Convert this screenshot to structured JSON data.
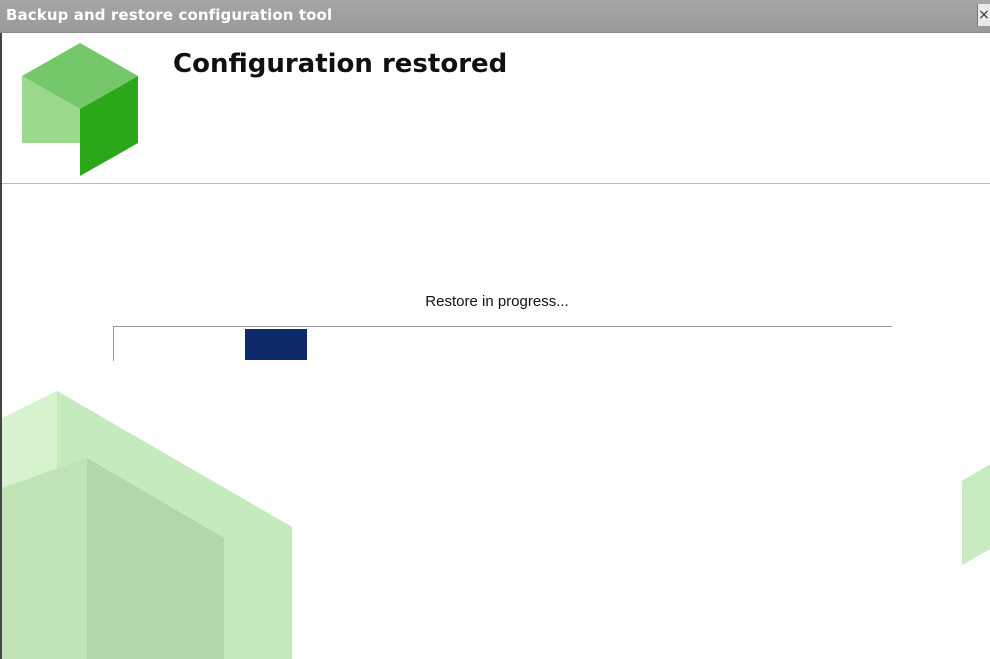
{
  "window": {
    "title": "Backup and restore configuration tool",
    "close_glyph": "×"
  },
  "header": {
    "title": "Configuration restored",
    "logo_icon": "green-cube-logo-icon"
  },
  "status": {
    "message": "Restore in progress...",
    "progress_fraction": 0.08,
    "progress_style": "marquee"
  },
  "colors": {
    "titlebar": "#a0a0a0",
    "progress_chunk": "#0f2a6b",
    "logo_light": "#8fd07f",
    "logo_dark": "#2aa81a",
    "decor": "#c8ecc0"
  }
}
